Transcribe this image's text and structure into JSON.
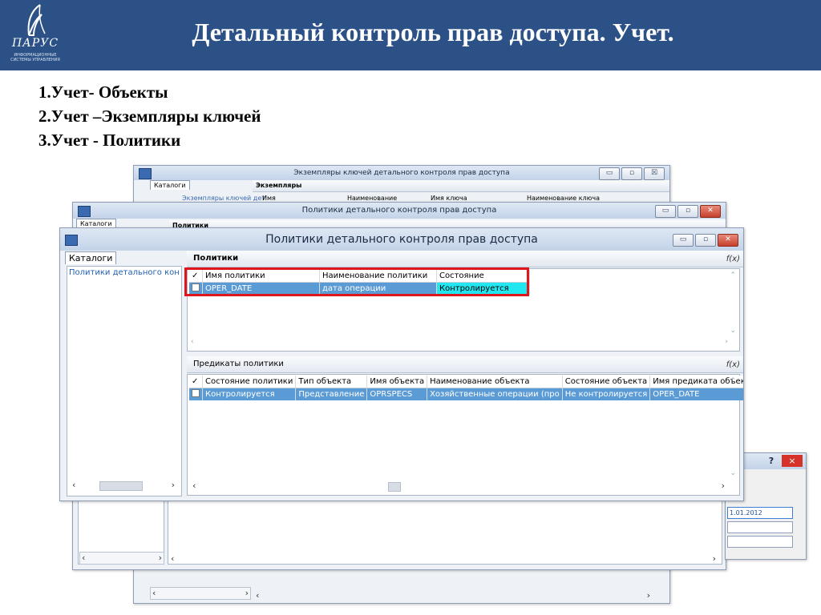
{
  "header": {
    "title": "Детальный контроль прав доступа. Учет.",
    "logo_brand": "ПАРУС",
    "logo_tagline": "ИНФОРМАЦИОННЫЕ СИСТЕМЫ УПРАВЛЕНИЯ"
  },
  "list": [
    "1.Учет- Объекты",
    "2.Учет –Экземпляры ключей",
    "3.Учет - Политики"
  ],
  "colors": {
    "header_bg": "#2b5187",
    "selection": "#5b9bd5",
    "highlight": "#22e6f0",
    "callout": "#e0161d"
  },
  "back_window": {
    "title": "Экземпляры ключей детального контроля прав доступа",
    "tab": "Каталоги",
    "tree_item": "Экземпляры ключей дет",
    "section": "Экземпляры",
    "columns": [
      "Имя",
      "Наименование",
      "Имя ключа",
      "Наименование ключа"
    ]
  },
  "mid_window": {
    "title": "Политики детального контроля прав доступа",
    "tab": "Каталоги",
    "section": "Политики"
  },
  "dialog": {
    "help": "?",
    "close": "×",
    "field_value": "1.01.2012"
  },
  "main_window": {
    "title": "Политики детального контроля прав доступа",
    "tab": "Каталоги",
    "tree_item": "Политики детального контро",
    "fx": "f(x)",
    "policies": {
      "section": "Политики",
      "columns": [
        "Имя политики",
        "Наименование политики",
        "Состояние"
      ],
      "rows": [
        {
          "name": "OPER_DATE",
          "desc": "дата операции",
          "state": "Контролируется"
        }
      ]
    },
    "predicates": {
      "section": "Предикаты политики",
      "columns": [
        "Состояние политики",
        "Тип объекта",
        "Имя объекта",
        "Наименование объекта",
        "Состояние объекта",
        "Имя предиката объек"
      ],
      "rows": [
        {
          "policy_state": "Контролируется",
          "object_type": "Представление",
          "object_name": "OPRSPECS",
          "object_desc": "Хозяйственные операции (про",
          "object_state": "Не контролируется",
          "predicate": "OPER_DATE"
        }
      ]
    }
  }
}
